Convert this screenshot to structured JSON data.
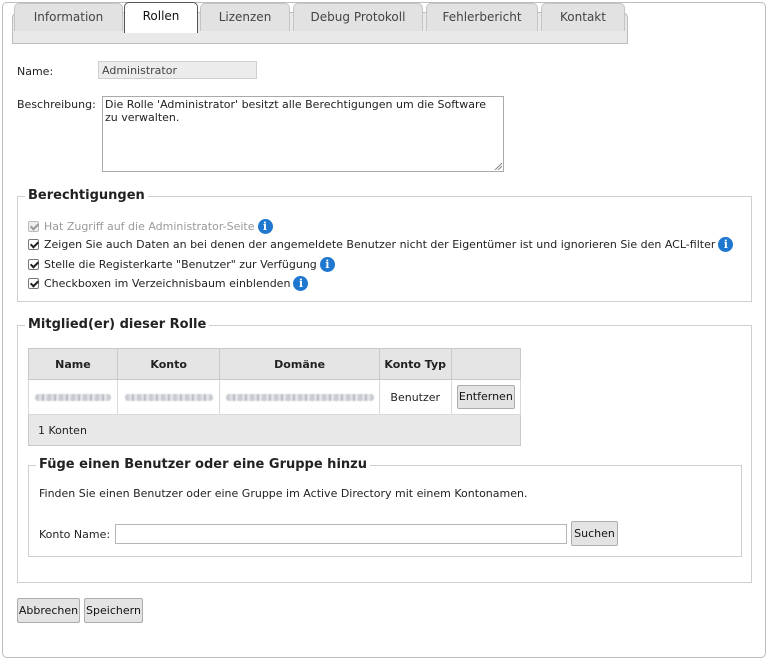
{
  "tabs": [
    {
      "label": "Information"
    },
    {
      "label": "Rollen"
    },
    {
      "label": "Lizenzen"
    },
    {
      "label": "Debug Protokoll"
    },
    {
      "label": "Fehlerbericht"
    },
    {
      "label": "Kontakt"
    }
  ],
  "form": {
    "name_label": "Name:",
    "name_value": "Administrator",
    "description_label": "Beschreibung:",
    "description_value": "Die Rolle 'Administrator' besitzt alle Berechtigungen um die Software zu verwalten."
  },
  "permissions": {
    "legend": "Berechtigungen",
    "items": [
      {
        "label": "Hat Zugriff auf die Administrator-Seite",
        "checked": true,
        "disabled": true
      },
      {
        "label": "Zeigen Sie auch Daten an bei denen der angemeldete Benutzer nicht der Eigentümer ist und ignorieren Sie den ACL-filter",
        "checked": true,
        "disabled": false
      },
      {
        "label": "Stelle die Registerkarte \"Benutzer\" zur Verfügung",
        "checked": true,
        "disabled": false
      },
      {
        "label": "Checkboxen im Verzeichnisbaum einblenden",
        "checked": true,
        "disabled": false
      }
    ],
    "info_glyph": "i"
  },
  "members": {
    "legend": "Mitglied(er) dieser Rolle",
    "columns": [
      "Name",
      "Konto",
      "Domäne",
      "Konto Typ",
      ""
    ],
    "rows": [
      {
        "type": "Benutzer",
        "remove_label": "Entfernen"
      }
    ],
    "footer": "1 Konten"
  },
  "add_member": {
    "legend": "Füge einen Benutzer oder eine Gruppe hinzu",
    "hint": "Finden Sie einen Benutzer oder eine Gruppe im Active Directory mit einem Kontonamen.",
    "account_label": "Konto Name:",
    "account_value": "",
    "search_label": "Suchen"
  },
  "actions": {
    "cancel_label": "Abbrechen",
    "save_label": "Speichern"
  },
  "colors": {
    "info_icon": "#1f77d0"
  }
}
